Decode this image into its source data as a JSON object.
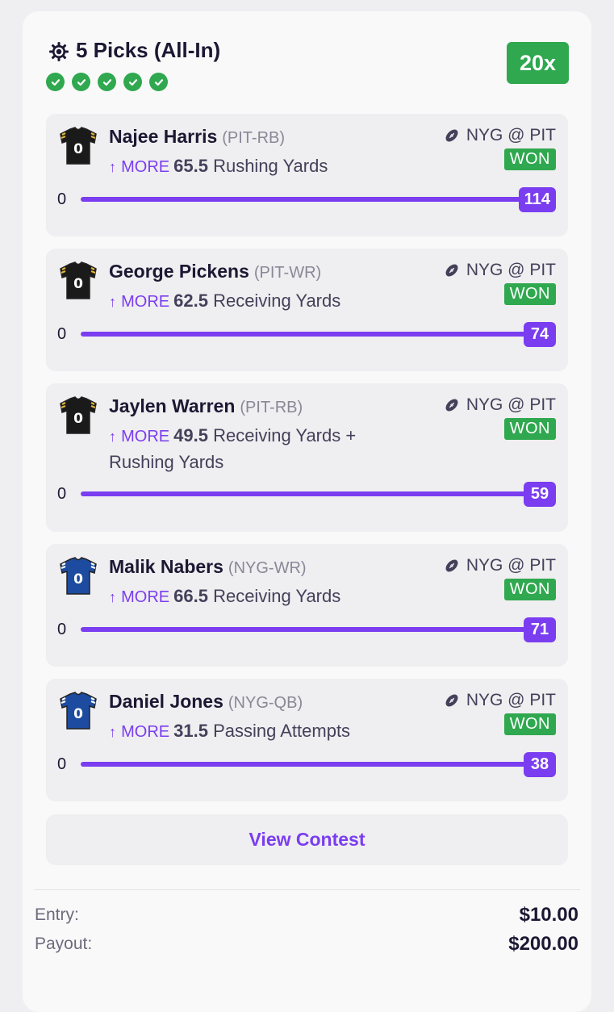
{
  "header": {
    "title": "5 Picks (All-In)",
    "multiplier": "20x",
    "icon": "gear-icon",
    "checks": 5
  },
  "colors": {
    "accent": "#7a3df0",
    "won": "#2fa84f",
    "pit_jersey": "#1a1a1a",
    "nyg_jersey": "#1c4ba0"
  },
  "picks": [
    {
      "player": "Najee Harris",
      "pos": "(PIT-RB)",
      "direction": "MORE",
      "line": "65.5",
      "stat": "Rushing Yards",
      "game": "NYG @ PIT",
      "result": "WON",
      "min": "0",
      "actual": "114",
      "team": "PIT"
    },
    {
      "player": "George Pickens",
      "pos": "(PIT-WR)",
      "direction": "MORE",
      "line": "62.5",
      "stat": "Receiving Yards",
      "game": "NYG @ PIT",
      "result": "WON",
      "min": "0",
      "actual": "74",
      "team": "PIT"
    },
    {
      "player": "Jaylen Warren",
      "pos": "(PIT-RB)",
      "direction": "MORE",
      "line": "49.5",
      "stat": "Receiving Yards + Rushing Yards",
      "game": "NYG @ PIT",
      "result": "WON",
      "min": "0",
      "actual": "59",
      "team": "PIT"
    },
    {
      "player": "Malik Nabers",
      "pos": "(NYG-WR)",
      "direction": "MORE",
      "line": "66.5",
      "stat": "Receiving Yards",
      "game": "NYG @ PIT",
      "result": "WON",
      "min": "0",
      "actual": "71",
      "team": "NYG"
    },
    {
      "player": "Daniel Jones",
      "pos": "(NYG-QB)",
      "direction": "MORE",
      "line": "31.5",
      "stat": "Passing Attempts",
      "game": "NYG @ PIT",
      "result": "WON",
      "min": "0",
      "actual": "38",
      "team": "NYG"
    }
  ],
  "view_contest": "View Contest",
  "summary": {
    "entry_label": "Entry:",
    "entry_value": "$10.00",
    "payout_label": "Payout:",
    "payout_value": "$200.00"
  }
}
